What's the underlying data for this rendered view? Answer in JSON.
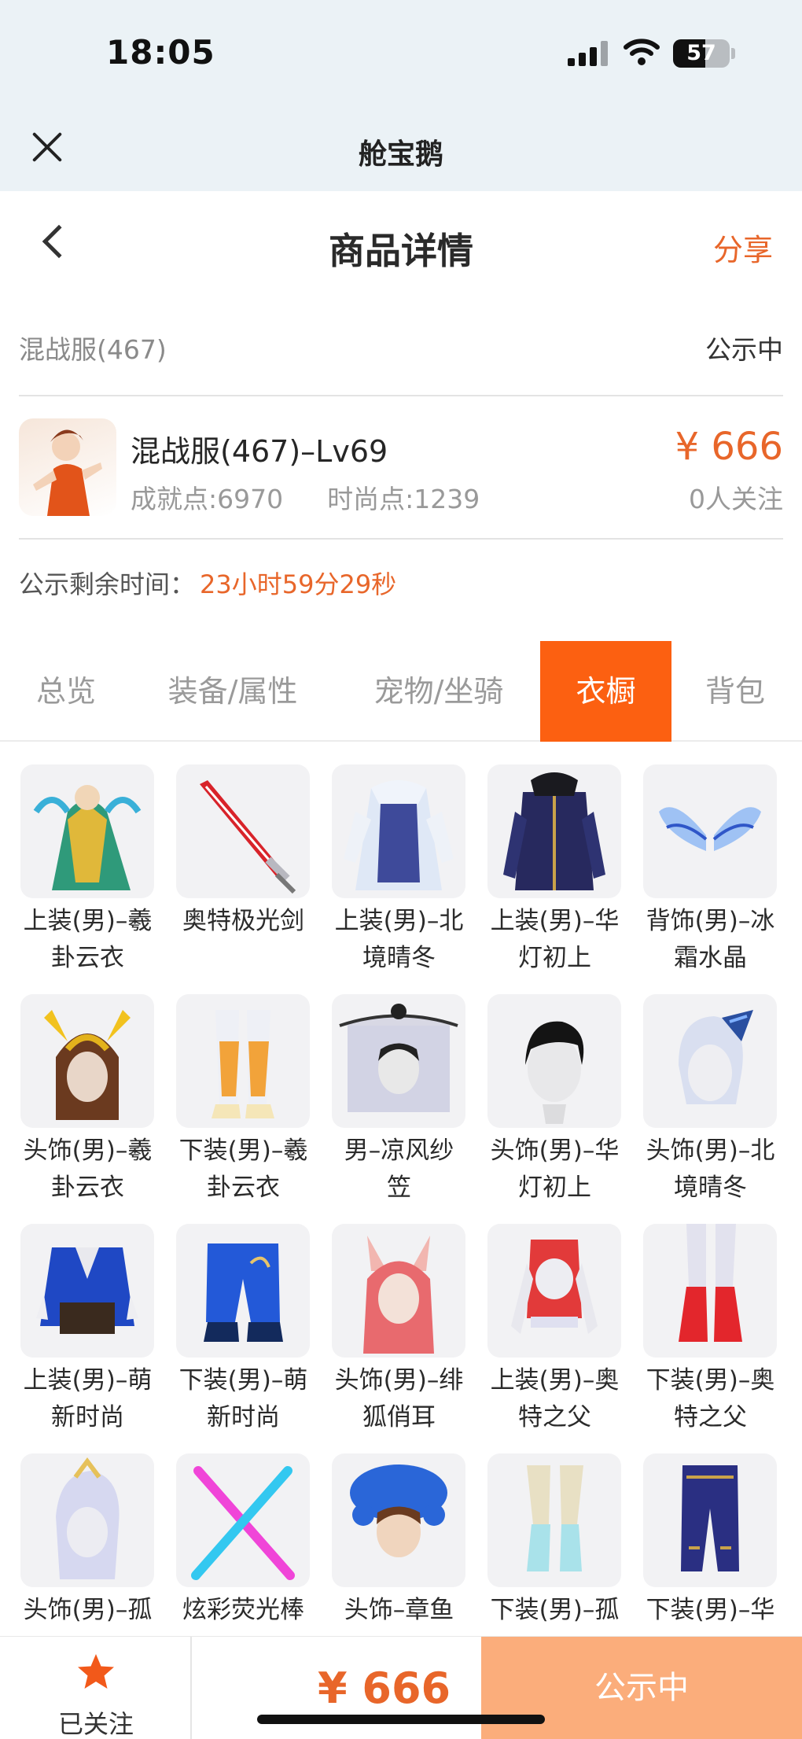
{
  "status": {
    "time": "18:05",
    "battery": "57",
    "battery_level": 0.57
  },
  "miniprogram": {
    "title": "舱宝鹅"
  },
  "header": {
    "title": "商品详情",
    "share": "分享"
  },
  "server": {
    "name": "混战服(467)",
    "status": "公示中"
  },
  "character": {
    "name": "混战服(467)–Lv69",
    "achievement": "成就点:6970",
    "fashion": "时尚点:1239",
    "price": "¥ 666",
    "followers": "0人关注"
  },
  "remaining": {
    "label": "公示剩余时间：",
    "value": "23小时59分29秒"
  },
  "tabs": [
    {
      "label": "总览"
    },
    {
      "label": "装备/属性"
    },
    {
      "label": "宠物/坐骑"
    },
    {
      "label": "衣橱",
      "active": true
    },
    {
      "label": "背包"
    }
  ],
  "wardrobe": [
    {
      "line1": "上装(男)–羲",
      "line2": "卦云衣"
    },
    {
      "line1": "奥特极光剑",
      "line2": ""
    },
    {
      "line1": "上装(男)–北",
      "line2": "境晴冬"
    },
    {
      "line1": "上装(男)–华",
      "line2": "灯初上"
    },
    {
      "line1": "背饰(男)–冰",
      "line2": "霜水晶"
    },
    {
      "line1": "头饰(男)–羲",
      "line2": "卦云衣"
    },
    {
      "line1": "下装(男)–羲",
      "line2": "卦云衣"
    },
    {
      "line1": "男–凉风纱",
      "line2": "笠"
    },
    {
      "line1": "头饰(男)–华",
      "line2": "灯初上"
    },
    {
      "line1": "头饰(男)–北",
      "line2": "境晴冬"
    },
    {
      "line1": "上装(男)–萌",
      "line2": "新时尚"
    },
    {
      "line1": "下装(男)–萌",
      "line2": "新时尚"
    },
    {
      "line1": "头饰(男)–绯",
      "line2": "狐俏耳"
    },
    {
      "line1": "上装(男)–奥",
      "line2": "特之父"
    },
    {
      "line1": "下装(男)–奥",
      "line2": "特之父"
    },
    {
      "line1": "头饰(男)–孤",
      "line2": ""
    },
    {
      "line1": "炫彩荧光棒",
      "line2": ""
    },
    {
      "line1": "头饰–章鱼",
      "line2": ""
    },
    {
      "line1": "下装(男)–孤",
      "line2": ""
    },
    {
      "line1": "下装(男)–华",
      "line2": ""
    }
  ],
  "bottom": {
    "follow_label": "已关注",
    "price": "¥ 666",
    "action": "公示中"
  },
  "colors": {
    "accent": "#fc6011",
    "price": "#e8662a",
    "action_bg": "#fbad7b",
    "topbar_bg": "#ebf2f6"
  }
}
